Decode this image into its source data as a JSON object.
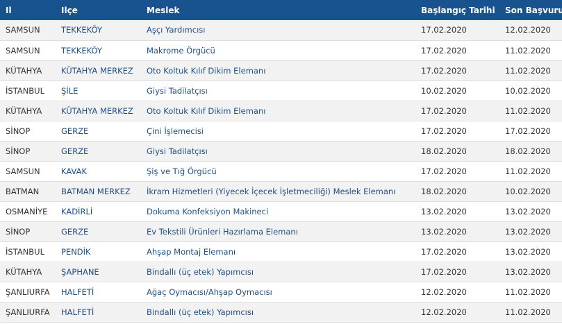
{
  "table": {
    "headers": {
      "il": "Il",
      "ilce": "Ilçe",
      "meslek": "Meslek",
      "baslangic": "Başlangıç Tarihi",
      "son_basvuru": "Son Başvuru T"
    },
    "rows": [
      {
        "il": "SAMSUN",
        "ilce": "TEKKEKÖY",
        "meslek": "Aşçı Yardımcısı",
        "baslangic": "17.02.2020",
        "son_basvuru": "12.02.2020"
      },
      {
        "il": "SAMSUN",
        "ilce": "TEKKEKÖY",
        "meslek": "Makrome Örgücü",
        "baslangic": "17.02.2020",
        "son_basvuru": "11.02.2020"
      },
      {
        "il": "KÜTAHYA",
        "ilce": "KÜTAHYA MERKEZ",
        "meslek": "Oto Koltuk Kılıf Dikim Elemanı",
        "baslangic": "17.02.2020",
        "son_basvuru": "11.02.2020"
      },
      {
        "il": "İSTANBUL",
        "ilce": "ŞİLE",
        "meslek": "Giysi Tadilatçısı",
        "baslangic": "10.02.2020",
        "son_basvuru": "10.02.2020"
      },
      {
        "il": "KÜTAHYA",
        "ilce": "KÜTAHYA MERKEZ",
        "meslek": "Oto Koltuk Kılıf Dikim Elemanı",
        "baslangic": "17.02.2020",
        "son_basvuru": "11.02.2020"
      },
      {
        "il": "SİNOP",
        "ilce": "GERZE",
        "meslek": "Çini İşlemecisi",
        "baslangic": "17.02.2020",
        "son_basvuru": "17.02.2020"
      },
      {
        "il": "SİNOP",
        "ilce": "GERZE",
        "meslek": "Giysi Tadilatçısı",
        "baslangic": "18.02.2020",
        "son_basvuru": "18.02.2020"
      },
      {
        "il": "SAMSUN",
        "ilce": "KAVAK",
        "meslek": "Şiş ve Tığ Örgücü",
        "baslangic": "17.02.2020",
        "son_basvuru": "11.02.2020"
      },
      {
        "il": "BATMAN",
        "ilce": "BATMAN MERKEZ",
        "meslek": "İkram Hizmetleri (Yiyecek İçecek İşletmeciliği) Meslek Elemanı",
        "baslangic": "18.02.2020",
        "son_basvuru": "10.02.2020"
      },
      {
        "il": "OSMANİYE",
        "ilce": "KADİRLİ",
        "meslek": "Dokuma Konfeksiyon Makineci",
        "baslangic": "13.02.2020",
        "son_basvuru": "13.02.2020"
      },
      {
        "il": "SİNOP",
        "ilce": "GERZE",
        "meslek": "Ev Tekstili Ürünleri Hazırlama Elemanı",
        "baslangic": "13.02.2020",
        "son_basvuru": "13.02.2020"
      },
      {
        "il": "İSTANBUL",
        "ilce": "PENDİK",
        "meslek": "Ahşap Montaj Elemanı",
        "baslangic": "17.02.2020",
        "son_basvuru": "13.02.2020"
      },
      {
        "il": "KÜTAHYA",
        "ilce": "ŞAPHANE",
        "meslek": "Bindallı (üç etek) Yapımcısı",
        "baslangic": "17.02.2020",
        "son_basvuru": "13.02.2020"
      },
      {
        "il": "ŞANLIURFA",
        "ilce": "HALFETİ",
        "meslek": "Ağaç Oymacısı/Ahşap Oymacısı",
        "baslangic": "12.02.2020",
        "son_basvuru": "11.02.2020"
      },
      {
        "il": "ŞANLIURFA",
        "ilce": "HALFETİ",
        "meslek": "Bindallı (üç etek) Yapımcısı",
        "baslangic": "12.02.2020",
        "son_basvuru": "11.02.2020"
      }
    ]
  }
}
